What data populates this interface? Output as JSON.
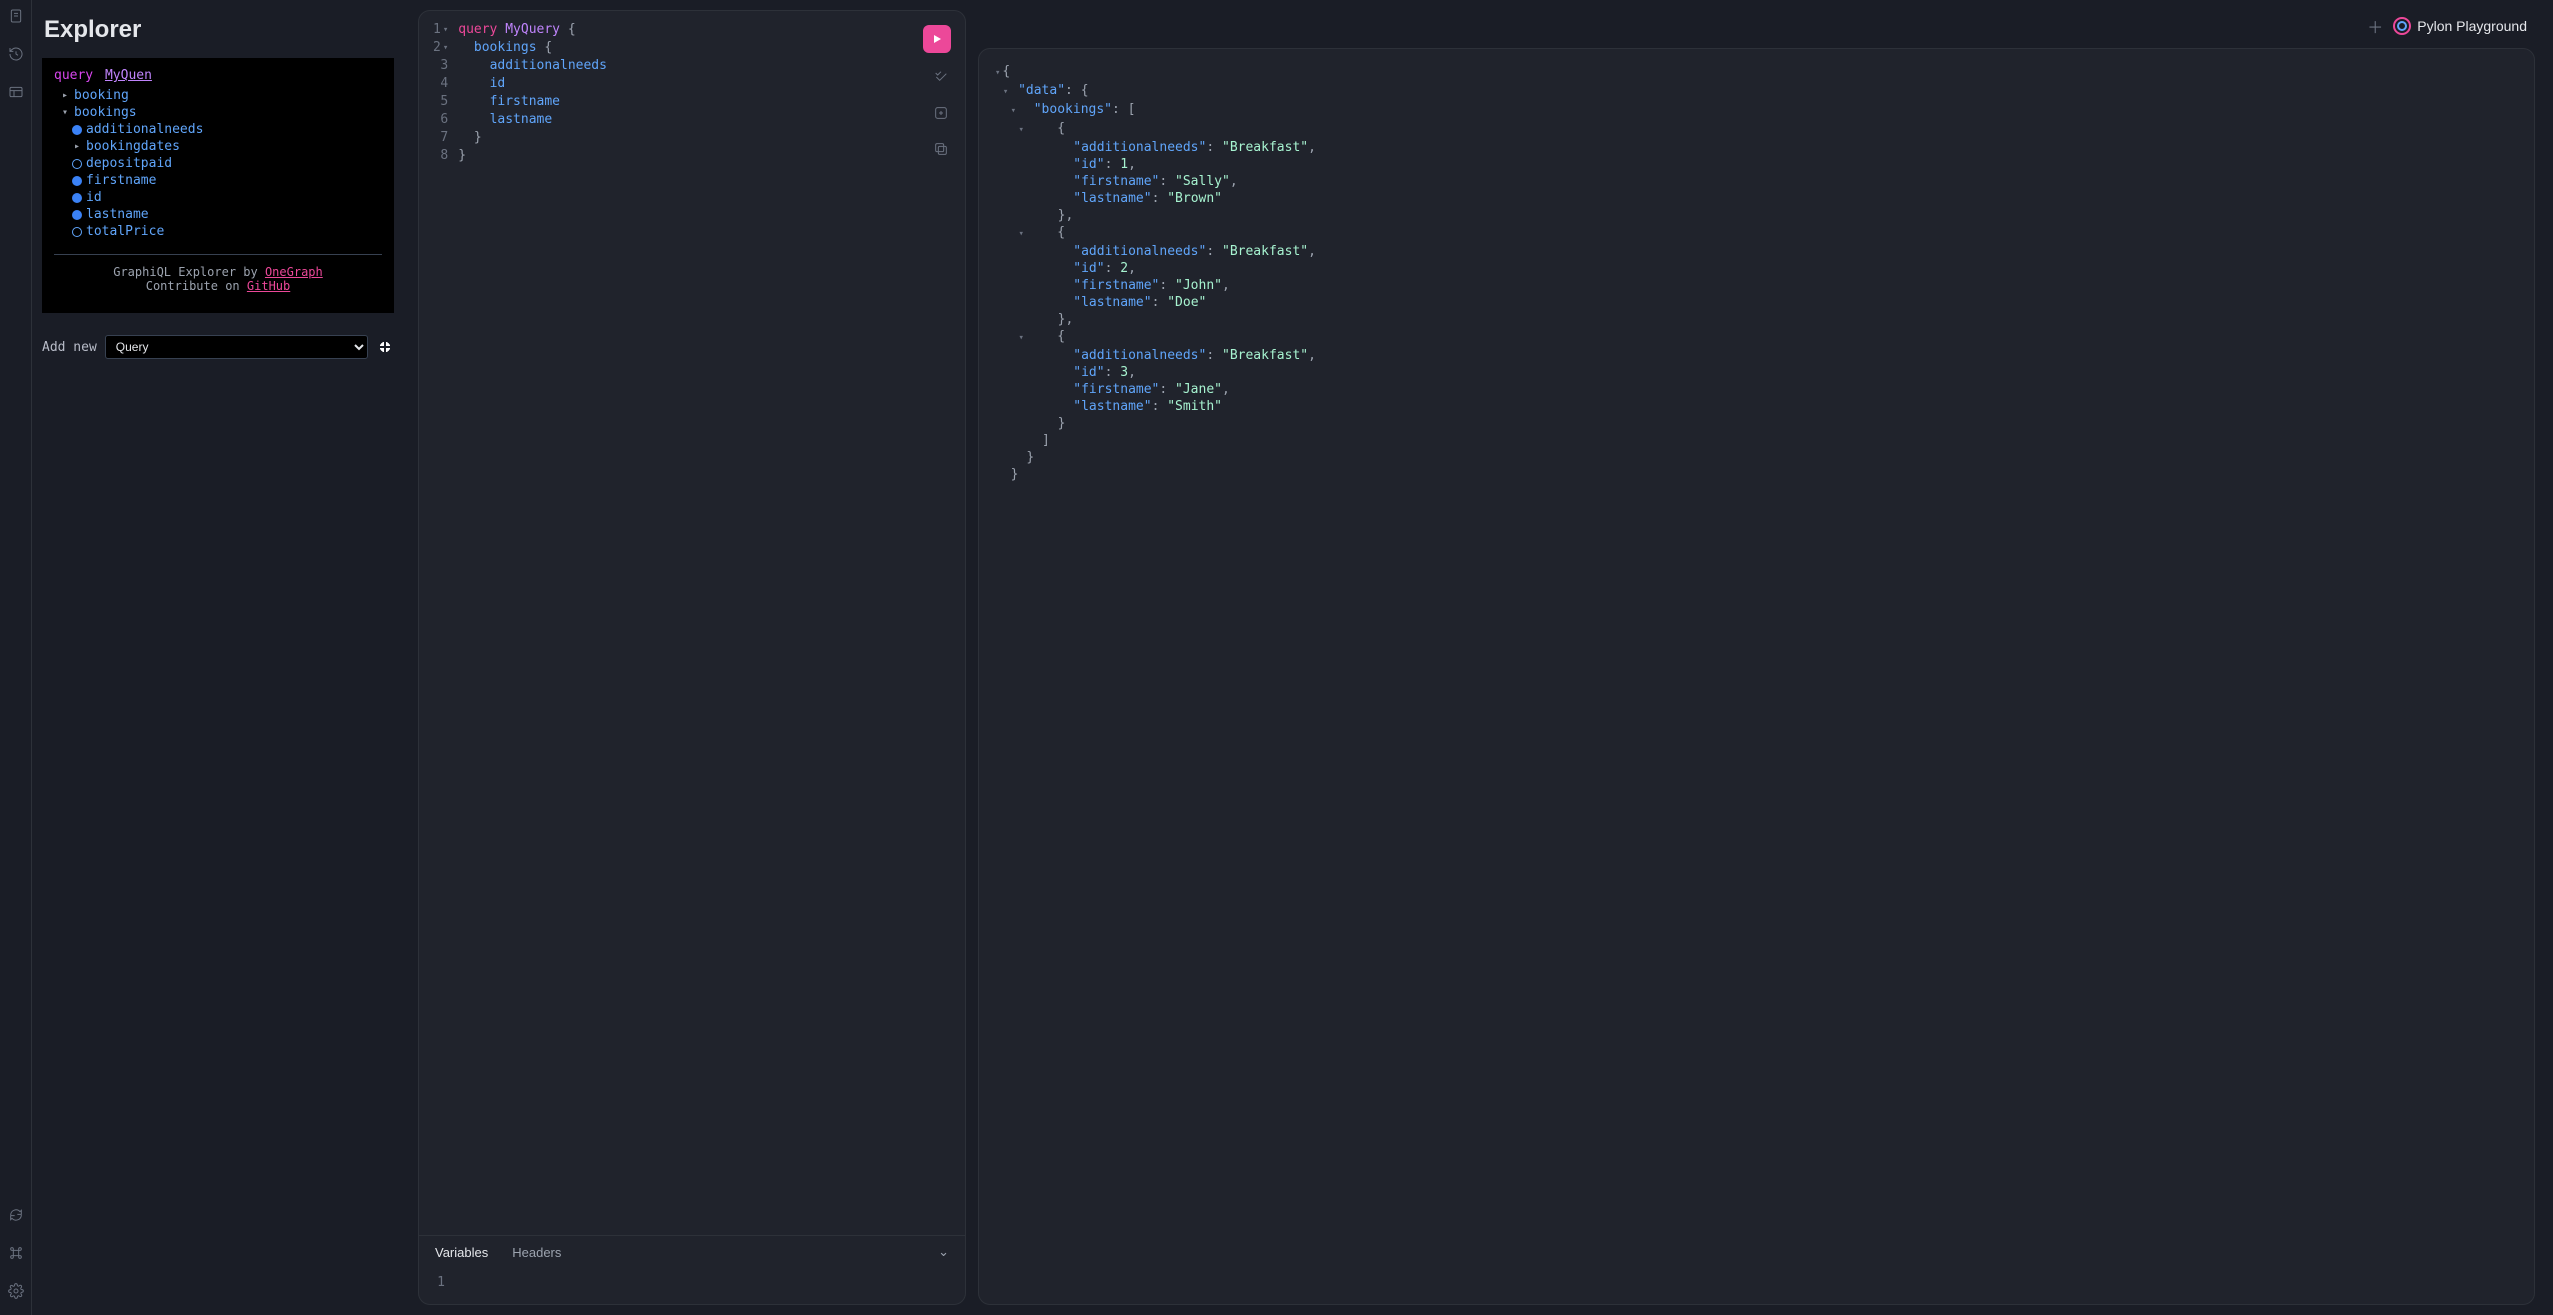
{
  "explorer": {
    "title": "Explorer",
    "query_kw": "query",
    "query_name": "MyQuen",
    "tree": [
      {
        "label": "booking",
        "kind": "arrow-right",
        "indent": 1
      },
      {
        "label": "bookings",
        "kind": "arrow-down",
        "indent": 1
      },
      {
        "label": "additionalneeds",
        "kind": "filled",
        "indent": 2
      },
      {
        "label": "bookingdates",
        "kind": "arrow-right",
        "indent": 2
      },
      {
        "label": "depositpaid",
        "kind": "empty",
        "indent": 2
      },
      {
        "label": "firstname",
        "kind": "filled",
        "indent": 2
      },
      {
        "label": "id",
        "kind": "filled",
        "indent": 2
      },
      {
        "label": "lastname",
        "kind": "filled",
        "indent": 2
      },
      {
        "label": "totalPrice",
        "kind": "empty",
        "indent": 2
      }
    ],
    "credit_pre": "GraphiQL Explorer by ",
    "credit_link": "OneGraph",
    "contrib_pre": "Contribute on ",
    "contrib_link": "GitHub",
    "add_new_label": "Add new",
    "add_new_option": "Query"
  },
  "editor": {
    "lines": [
      {
        "n": 1,
        "fold": "▾",
        "tokens": [
          [
            "kw",
            "query "
          ],
          [
            "name",
            "MyQuery"
          ],
          [
            "punc",
            " {"
          ]
        ]
      },
      {
        "n": 2,
        "fold": "▾",
        "tokens": [
          [
            "punc",
            "  "
          ],
          [
            "field",
            "bookings"
          ],
          [
            "punc",
            " {"
          ]
        ]
      },
      {
        "n": 3,
        "tokens": [
          [
            "punc",
            "    "
          ],
          [
            "field",
            "additionalneeds"
          ]
        ]
      },
      {
        "n": 4,
        "tokens": [
          [
            "punc",
            "    "
          ],
          [
            "field",
            "id"
          ]
        ]
      },
      {
        "n": 5,
        "tokens": [
          [
            "punc",
            "    "
          ],
          [
            "field",
            "firstname"
          ]
        ]
      },
      {
        "n": 6,
        "tokens": [
          [
            "punc",
            "    "
          ],
          [
            "field",
            "lastname"
          ]
        ]
      },
      {
        "n": 7,
        "tokens": [
          [
            "punc",
            "  }"
          ]
        ]
      },
      {
        "n": 8,
        "tokens": [
          [
            "punc",
            "}"
          ]
        ]
      }
    ],
    "tabs": {
      "variables": "Variables",
      "headers": "Headers"
    },
    "vars_gutter": "1"
  },
  "header": {
    "brand": "Pylon Playground"
  },
  "response": {
    "data": {
      "bookings": [
        {
          "additionalneeds": "Breakfast",
          "id": 1,
          "firstname": "Sally",
          "lastname": "Brown"
        },
        {
          "additionalneeds": "Breakfast",
          "id": 2,
          "firstname": "John",
          "lastname": "Doe"
        },
        {
          "additionalneeds": "Breakfast",
          "id": 3,
          "firstname": "Jane",
          "lastname": "Smith"
        }
      ]
    }
  }
}
